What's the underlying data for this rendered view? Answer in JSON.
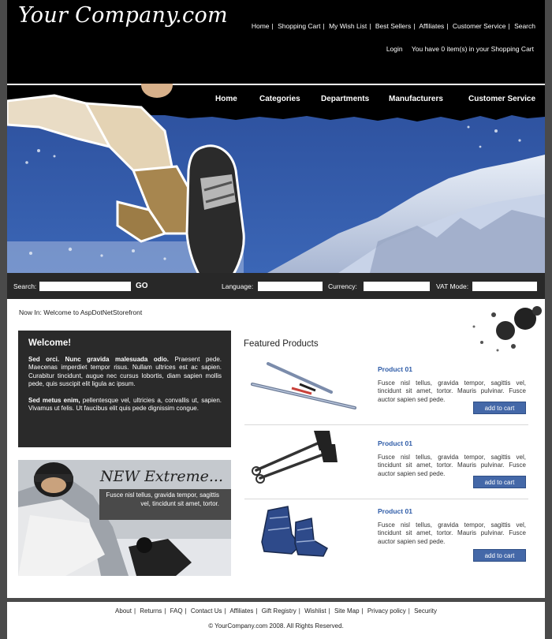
{
  "header": {
    "logo": "Your Company.com",
    "top_links": [
      "Home",
      "Shopping Cart",
      "My Wish List",
      "Best Sellers",
      "Affiliates",
      "Customer Service",
      "Search"
    ],
    "login": "Login",
    "cart_text": "You have 0 item(s) in your  Shopping Cart"
  },
  "main_nav": [
    "Home",
    "Categories",
    "Departments",
    "Manufacturers",
    "Customer Service"
  ],
  "searchbar": {
    "search_label": "Search:",
    "go": "GO",
    "language_label": "Language:",
    "currency_label": "Currency:",
    "vat_label": "VAT Mode:"
  },
  "breadcrumb": {
    "prefix": "Now In:",
    "location": "Welcome to AspDotNetStorefront"
  },
  "welcome": {
    "title": "Welcome!",
    "p1_bold": "Sed orci. Nunc gravida malesuada odio.",
    "p1_text": " Praesent pede. Maecenas imperdiet tempor risus. Nullam ultrices est ac sapien. Curabitur tincidunt, augue nec cursus lobortis, diam sapien mollis pede, quis suscipit elit ligula ac ipsum.",
    "p2_bold": "Sed metus enim,",
    "p2_text": " pellentesque vel, ultricies a, convallis ut, sapien. Vivamus ut felis. Ut faucibus elit quis pede dignissim congue."
  },
  "promo": {
    "title": "NEW Extreme...",
    "text": "Fusce nisl tellus, gravida tempor, sagittis vel, tincidunt sit amet, tortor."
  },
  "featured": {
    "title": "Featured Products",
    "products": [
      {
        "name": "Product 01",
        "desc": "Fusce nisl tellus, gravida tempor, sagittis vel, tincidunt sit amet, tortor. Mauris pulvinar. Fusce auctor sapien sed pede.",
        "button": "add to cart"
      },
      {
        "name": "Product 01",
        "desc": "Fusce nisl tellus, gravida tempor, sagittis vel, tincidunt sit amet, tortor. Mauris pulvinar. Fusce auctor sapien sed pede.",
        "button": "add to cart"
      },
      {
        "name": "Product 01",
        "desc": "Fusce nisl tellus, gravida tempor, sagittis vel, tincidunt sit amet, tortor. Mauris pulvinar. Fusce auctor sapien sed pede.",
        "button": "add to cart"
      }
    ]
  },
  "footer": {
    "links": [
      "About",
      "Returns",
      "FAQ",
      "Contact Us",
      "Affiliates",
      "Gift Registry",
      "Wishlist",
      "Site Map",
      "Privacy policy",
      "Security"
    ],
    "copyright": "© YourCompany.com 2008. All Rights Reserved."
  },
  "colors": {
    "accent_blue": "#2f5ca8",
    "button_blue": "#4468a8",
    "sky_blue": "#2f57a5",
    "dark": "#000000"
  }
}
